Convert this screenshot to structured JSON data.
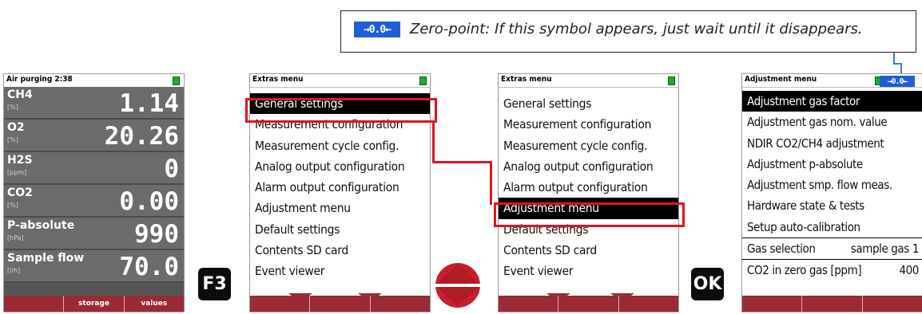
{
  "callout": {
    "icon_text": "→0.0←",
    "text": "Zero-point: If this symbol appears, just wait until it disappears."
  },
  "screen1": {
    "title": "Air purging  2:38",
    "measurements": [
      {
        "name": "CH4",
        "unit": "[%]",
        "value": "1.14"
      },
      {
        "name": "O2",
        "unit": "[%]",
        "value": "20.26"
      },
      {
        "name": "H2S",
        "unit": "[ppm]",
        "value": "0"
      },
      {
        "name": "CO2",
        "unit": "[%]",
        "value": "0.00"
      },
      {
        "name": "P-absolute",
        "unit": "[hPa]",
        "value": "990"
      },
      {
        "name": "Sample flow",
        "unit": "[l/h]",
        "value": "70.0"
      }
    ],
    "softkeys": [
      "",
      "storage",
      "values"
    ]
  },
  "keys": {
    "f3": "F3",
    "ok": "OK"
  },
  "screen2": {
    "title": "Extras menu",
    "items": [
      "General settings",
      "Measurement configuration",
      "Measurement cycle config.",
      "Analog output configuration",
      "Alarm output configuration",
      "Adjustment menu",
      "Default settings",
      "Contents SD card",
      "Event viewer"
    ]
  },
  "screen3": {
    "title": "Extras menu",
    "items": [
      "General settings",
      "Measurement configuration",
      "Measurement cycle config.",
      "Analog output configuration",
      "Alarm output configuration",
      "Adjustment menu",
      "Default settings",
      "Contents SD card",
      "Event viewer"
    ]
  },
  "screen4": {
    "title": "Adjustment menu",
    "zero_icon": "→0.0←",
    "items": [
      "Adjustment gas factor",
      "Adjustment gas nom. value",
      "NDIR CO2/CH4 adjustment",
      "Adjustment p-absolute",
      "Adjustment smp. flow meas.",
      "Hardware state & tests",
      "Setup auto-calibration"
    ],
    "gas_selection": {
      "label": "Gas selection",
      "value": "sample gas 1"
    },
    "co2_zero": {
      "label": "CO2 in zero gas [ppm]",
      "value": "400"
    }
  }
}
